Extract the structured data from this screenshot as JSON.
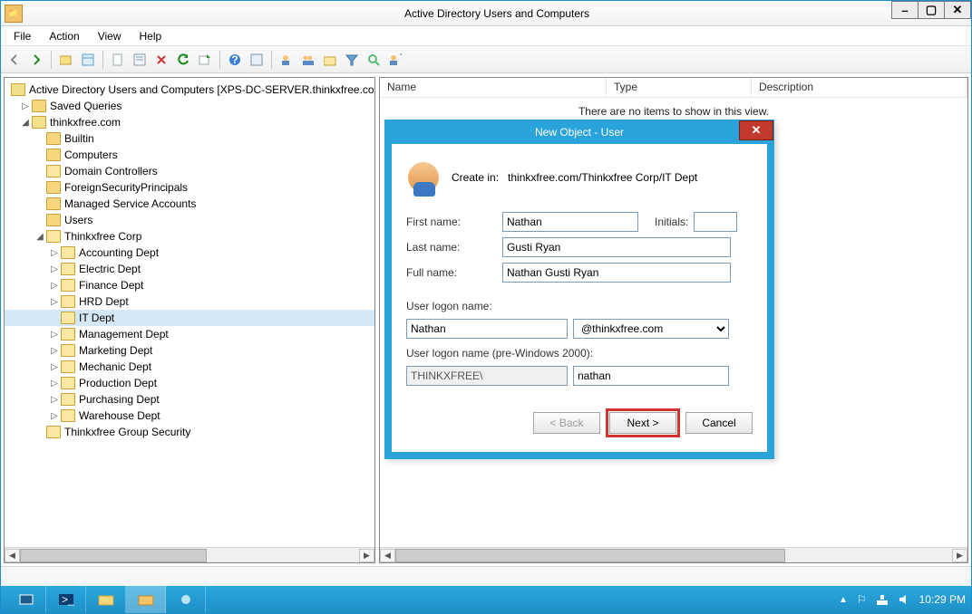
{
  "window": {
    "title": "Active Directory Users and Computers"
  },
  "menu": {
    "file": "File",
    "action": "Action",
    "view": "View",
    "help": "Help"
  },
  "tree": {
    "root": "Active Directory Users and Computers [XPS-DC-SERVER.thinkxfree.com]",
    "saved": "Saved Queries",
    "domain": "thinkxfree.com",
    "builtin": "Builtin",
    "computers": "Computers",
    "dcs": "Domain Controllers",
    "fsp": "ForeignSecurityPrincipals",
    "msa": "Managed Service Accounts",
    "users": "Users",
    "corp": "Thinkxfree Corp",
    "dept": {
      "acct": "Accounting Dept",
      "elec": "Electric Dept",
      "fin": "Finance Dept",
      "hrd": "HRD Dept",
      "it": "IT Dept",
      "mgmt": "Management Dept",
      "mkt": "Marketing Dept",
      "mech": "Mechanic Dept",
      "prod": "Production Dept",
      "purch": "Purchasing Dept",
      "wh": "Warehouse Dept"
    },
    "groupsec": "Thinkxfree Group Security"
  },
  "list": {
    "cols": {
      "name": "Name",
      "type": "Type",
      "desc": "Description"
    },
    "empty": "There are no items to show in this view."
  },
  "dialog": {
    "title": "New Object - User",
    "create_in_label": "Create in:",
    "create_in_path": "thinkxfree.com/Thinkxfree Corp/IT Dept",
    "first_name_label": "First name:",
    "first_name": "Nathan",
    "initials_label": "Initials:",
    "initials": "",
    "last_name_label": "Last name:",
    "last_name": "Gusti Ryan",
    "full_name_label": "Full name:",
    "full_name": "Nathan Gusti Ryan",
    "logon_label": "User logon name:",
    "logon": "Nathan",
    "domain": "@thinkxfree.com",
    "logon2000_label": "User logon name (pre-Windows 2000):",
    "nt_domain": "THINKXFREE\\",
    "nt_user": "nathan",
    "back": "< Back",
    "next": "Next >",
    "cancel": "Cancel"
  },
  "taskbar": {
    "time": "10:29 PM"
  }
}
